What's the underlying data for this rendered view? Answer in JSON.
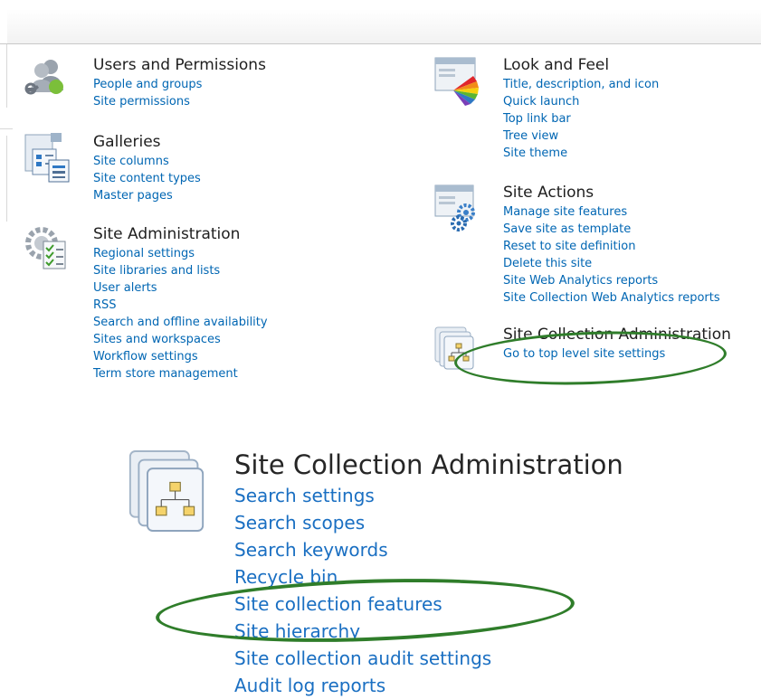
{
  "sections": {
    "users": {
      "title": "Users and Permissions",
      "links": [
        "People and groups",
        "Site permissions"
      ]
    },
    "galleries": {
      "title": "Galleries",
      "links": [
        "Site columns",
        "Site content types",
        "Master pages"
      ]
    },
    "site_admin": {
      "title": "Site Administration",
      "links": [
        "Regional settings",
        "Site libraries and lists",
        "User alerts",
        "RSS",
        "Search and offline availability",
        "Sites and workspaces",
        "Workflow settings",
        "Term store management"
      ]
    },
    "look_feel": {
      "title": "Look and Feel",
      "links": [
        "Title, description, and icon",
        "Quick launch",
        "Top link bar",
        "Tree view",
        "Site theme"
      ]
    },
    "site_actions": {
      "title": "Site Actions",
      "links": [
        "Manage site features",
        "Save site as template",
        "Reset to site definition",
        "Delete this site",
        "Site Web Analytics reports",
        "Site Collection Web Analytics reports"
      ]
    },
    "sca_small": {
      "title": "Site Collection Administration",
      "links": [
        "Go to top level site settings"
      ]
    },
    "sca_big": {
      "title": "Site Collection Administration",
      "links": [
        "Search settings",
        "Search scopes",
        "Search keywords",
        "Recycle bin",
        "Site collection features",
        "Site hierarchy",
        "Site collection audit settings",
        "Audit log reports"
      ]
    }
  },
  "icons": {
    "users": "users-permissions-icon",
    "galleries": "galleries-icon",
    "site_admin": "site-administration-icon",
    "look_feel": "look-and-feel-icon",
    "site_actions": "site-actions-icon",
    "sca": "site-collection-admin-icon"
  },
  "colors": {
    "link": "#0066b3",
    "highlight": "#2f7d2a"
  }
}
